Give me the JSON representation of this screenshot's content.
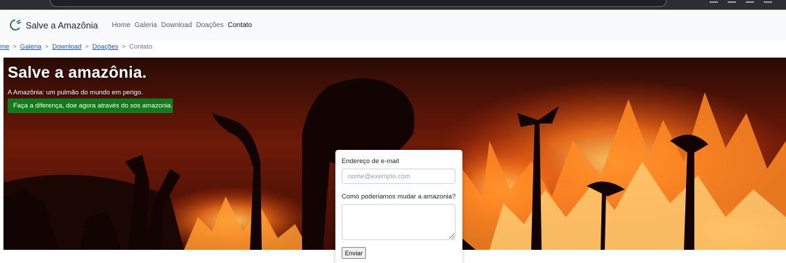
{
  "browser": {
    "url": ""
  },
  "navbar": {
    "brand": "Salve a Amazônia",
    "links": [
      "Home",
      "Galeria",
      "Download",
      "Doações",
      "Contato"
    ],
    "active_link": "Contato"
  },
  "breadcrumb": {
    "items": [
      "Home",
      "Galeria",
      "Download",
      "Doações"
    ],
    "visible_first_item": "Home",
    "separator": ">",
    "current": "Contato"
  },
  "hero": {
    "title": "Salve a amazônia.",
    "subtitle": "A Amazônia: um pulmão do mundo em perigo.",
    "cta": "Faça a diferença, doe agora através do sos amazonia."
  },
  "form": {
    "email_label": "Endereço de e-mail",
    "email_placeholder": "nome@exemplo.com",
    "email_value": "",
    "message_label": "Como poderiamos mudar a amazonia?",
    "message_value": "",
    "submit_label": "Enviar"
  },
  "colors": {
    "navbar_bg": "#f8f9fa",
    "link": "#1a56c4",
    "cta_bg": "#127a1a",
    "fire_bright": "#ffb347",
    "fire_deep": "#c4300a"
  }
}
